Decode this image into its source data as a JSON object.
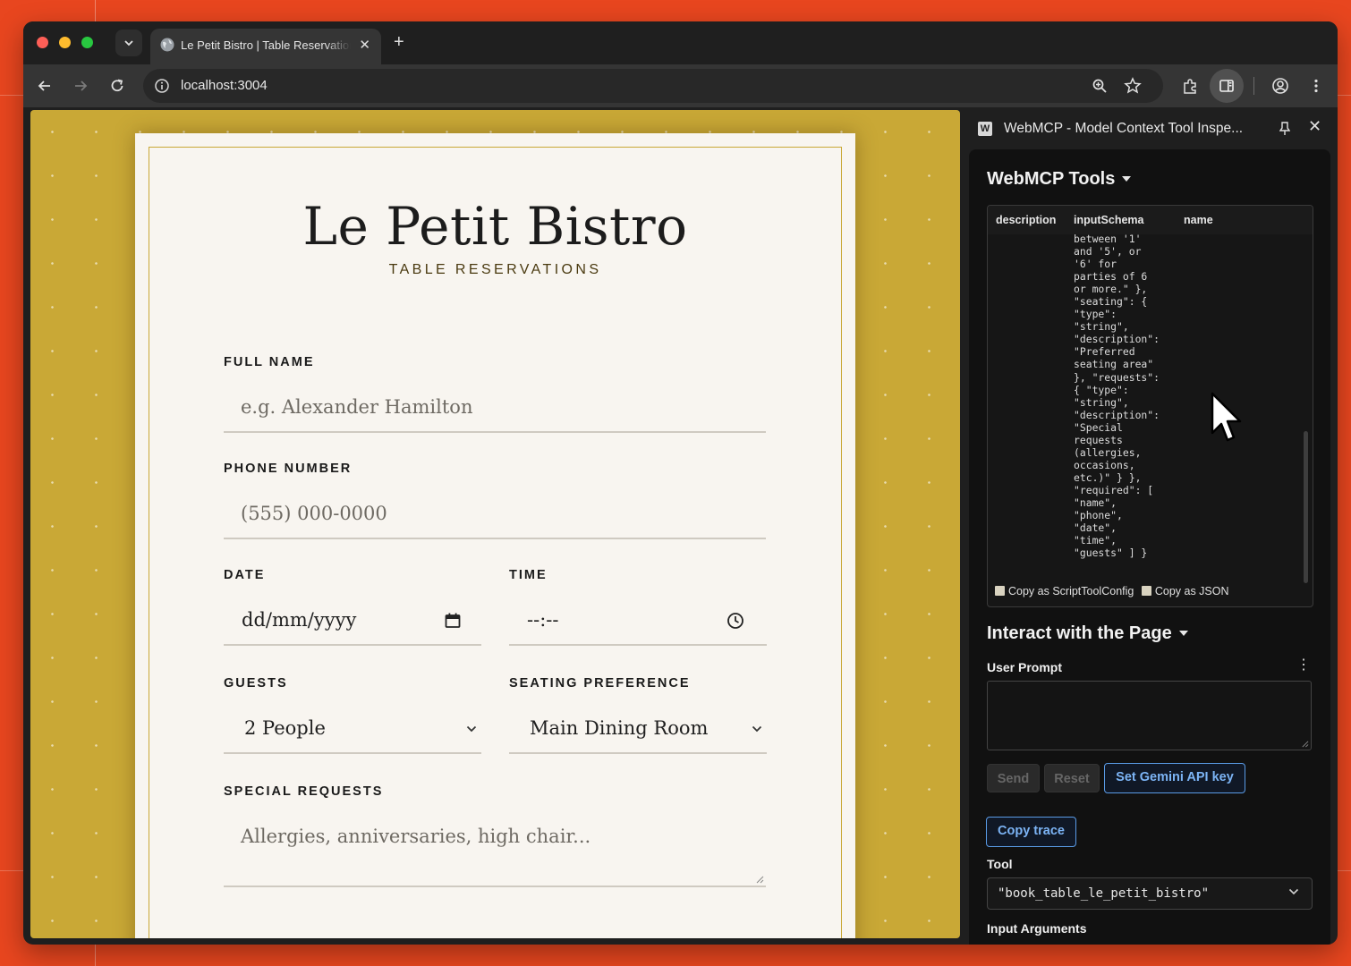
{
  "browser": {
    "tab_title": "Le Petit Bistro | Table Reservations",
    "new_tab": "+",
    "tab_close": "✕",
    "url": "localhost:3004"
  },
  "page": {
    "brand": "Le Petit Bistro",
    "subtitle": "TABLE RESERVATIONS",
    "full_name": {
      "label": "FULL NAME",
      "placeholder": "e.g. Alexander Hamilton"
    },
    "phone": {
      "label": "PHONE NUMBER",
      "placeholder": "(555) 000-0000"
    },
    "date": {
      "label": "DATE",
      "placeholder": "dd/mm/yyyy"
    },
    "time": {
      "label": "TIME",
      "placeholder": "--:--"
    },
    "guests": {
      "label": "GUESTS",
      "value": "2 People"
    },
    "seating": {
      "label": "SEATING PREFERENCE",
      "value": "Main Dining Room"
    },
    "requests": {
      "label": "SPECIAL REQUESTS",
      "placeholder": "Allergies, anniversaries, high chair..."
    }
  },
  "side_panel": {
    "logo": "W",
    "title": "WebMCP - Model Context Tool Inspe...",
    "close": "✕",
    "tools_heading": "WebMCP Tools",
    "columns": [
      "description",
      "inputSchema",
      "name"
    ],
    "schema_text": "between '1'\nand '5', or\n'6' for\nparties of 6\nor more.\" },\n\"seating\": {\n\"type\":\n\"string\",\n\"description\":\n\"Preferred\nseating area\"\n}, \"requests\":\n{ \"type\":\n\"string\",\n\"description\":\n\"Special\nrequests\n(allergies,\noccasions,\netc.)\" } },\n\"required\": [\n\"name\",\n\"phone\",\n\"date\",\n\"time\",\n\"guests\" ] }",
    "copy_script": "Copy as ScriptToolConfig",
    "copy_json": "Copy as JSON",
    "interact_heading": "Interact with the Page",
    "user_prompt_label": "User Prompt",
    "kebab": "⋮",
    "buttons": {
      "send": "Send",
      "reset": "Reset",
      "set_key": "Set Gemini API key",
      "copy_trace": "Copy trace"
    },
    "tool_label": "Tool",
    "tool_value": "\"book_table_le_petit_bistro\"",
    "input_args_label": "Input Arguments"
  },
  "colors": {
    "desktop": "#e8461f",
    "page_background": "#c9a836",
    "card": "#f8f5f0",
    "accent_blue": "#5a9be6"
  }
}
